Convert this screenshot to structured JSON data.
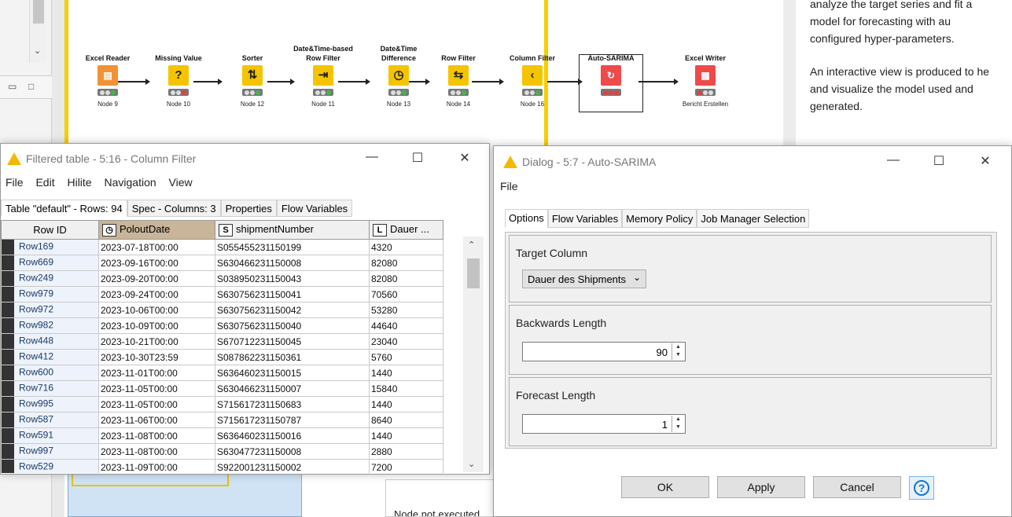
{
  "workflow": {
    "nodes": [
      {
        "title": "Excel Reader",
        "label": "Node 9",
        "icon": "excel-read-icon"
      },
      {
        "title": "Missing Value",
        "label": "Node 10",
        "icon": "question-icon"
      },
      {
        "title": "Sorter",
        "label": "Node 12",
        "icon": "sort-icon"
      },
      {
        "title": "Date&Time-based Row Filter",
        "label": "Node 11",
        "icon": "datetime-filter-icon"
      },
      {
        "title": "Date&Time Difference",
        "label": "Node 13",
        "icon": "clock-icon"
      },
      {
        "title": "Row Filter",
        "label": "Node 14",
        "icon": "row-filter-icon"
      },
      {
        "title": "Column Filter",
        "label": "Node 16",
        "icon": "column-filter-icon"
      },
      {
        "title": "Auto-SARIMA",
        "label": "",
        "icon": "sarima-icon"
      },
      {
        "title": "Excel Writer",
        "label": "Bericht Erstellen",
        "icon": "excel-write-icon"
      }
    ]
  },
  "description": {
    "lines": [
      "analyze the target series and fit a",
      "model for forecasting with au",
      "configured hyper-parameters.",
      "An interactive view is produced to he",
      "and visualize the model used and",
      "generated."
    ]
  },
  "bottom": {
    "node_status": "Node not executed"
  },
  "table_window": {
    "title": "Filtered table - 5:16 - Column Filter",
    "menu": [
      "File",
      "Edit",
      "Hilite",
      "Navigation",
      "View"
    ],
    "tabs": [
      "Table \"default\" - Rows: 94",
      "Spec - Columns: 3",
      "Properties",
      "Flow Variables"
    ],
    "columns": [
      {
        "name": "Row ID",
        "type": ""
      },
      {
        "name": "PoloutDate",
        "type": "date"
      },
      {
        "name": "shipmentNumber",
        "type": "S"
      },
      {
        "name": "Dauer ...",
        "type": "L"
      }
    ],
    "rows": [
      [
        "Row169",
        "2023-07-18T00:00",
        "S055455231150199",
        "4320"
      ],
      [
        "Row669",
        "2023-09-16T00:00",
        "S630466231150008",
        "82080"
      ],
      [
        "Row249",
        "2023-09-20T00:00",
        "S038950231150043",
        "82080"
      ],
      [
        "Row979",
        "2023-09-24T00:00",
        "S630756231150041",
        "70560"
      ],
      [
        "Row972",
        "2023-10-06T00:00",
        "S630756231150042",
        "53280"
      ],
      [
        "Row982",
        "2023-10-09T00:00",
        "S630756231150040",
        "44640"
      ],
      [
        "Row448",
        "2023-10-21T00:00",
        "S670712231150045",
        "23040"
      ],
      [
        "Row412",
        "2023-10-30T23:59",
        "S087862231150361",
        "5760"
      ],
      [
        "Row600",
        "2023-11-01T00:00",
        "S636460231150015",
        "1440"
      ],
      [
        "Row716",
        "2023-11-05T00:00",
        "S630466231150007",
        "15840"
      ],
      [
        "Row995",
        "2023-11-05T00:00",
        "S715617231150683",
        "1440"
      ],
      [
        "Row587",
        "2023-11-06T00:00",
        "S715617231150787",
        "8640"
      ],
      [
        "Row591",
        "2023-11-08T00:00",
        "S636460231150016",
        "1440"
      ],
      [
        "Row997",
        "2023-11-08T00:00",
        "S630477231150008",
        "2880"
      ],
      [
        "Row529",
        "2023-11-09T00:00",
        "S922001231150002",
        "7200"
      ]
    ]
  },
  "dialog": {
    "title": "Dialog - 5:7 - Auto-SARIMA",
    "menu_file": "File",
    "tabs": [
      "Options",
      "Flow Variables",
      "Memory Policy",
      "Job Manager Selection"
    ],
    "target_column_label": "Target Column",
    "target_column_value": "Dauer des Shipments",
    "backwards_label": "Backwards Length",
    "backwards_value": "90",
    "forecast_label": "Forecast Length",
    "forecast_value": "1",
    "buttons": {
      "ok": "OK",
      "apply": "Apply",
      "cancel": "Cancel",
      "help": "?"
    }
  }
}
